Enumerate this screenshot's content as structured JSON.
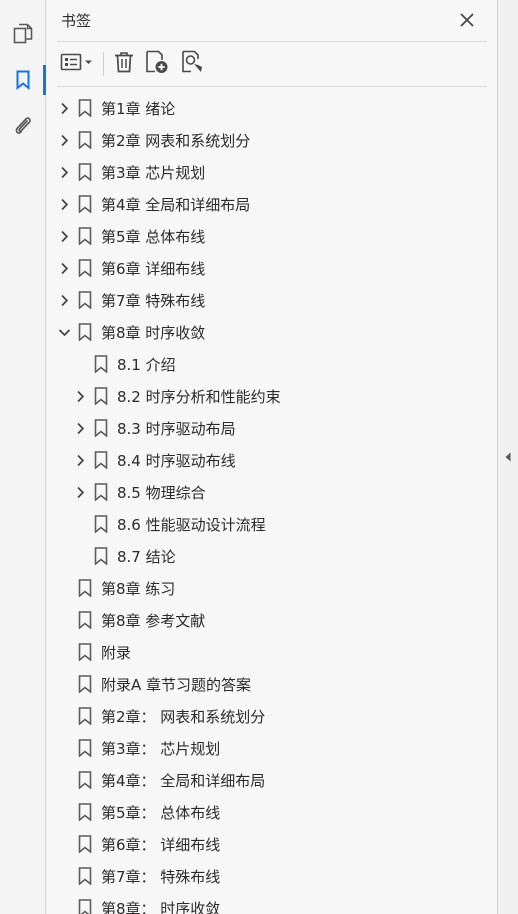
{
  "left_rail": {
    "items": [
      {
        "icon": "pages-icon",
        "active": false
      },
      {
        "icon": "bookmark-icon",
        "active": true
      },
      {
        "icon": "paperclip-icon",
        "active": false
      }
    ],
    "accent": "#1473e6"
  },
  "panel": {
    "title": "书签",
    "toolbar": [
      {
        "icon": "options-menu-icon"
      },
      {
        "icon": "delete-icon"
      },
      {
        "icon": "new-bookmark-icon"
      },
      {
        "icon": "find-bookmark-icon"
      }
    ]
  },
  "bookmarks": [
    {
      "label": "第1章 绪论",
      "level": 0,
      "expandable": true,
      "expanded": false
    },
    {
      "label": "第2章 网表和系统划分",
      "level": 0,
      "expandable": true,
      "expanded": false
    },
    {
      "label": "第3章 芯片规划",
      "level": 0,
      "expandable": true,
      "expanded": false
    },
    {
      "label": "第4章 全局和详细布局",
      "level": 0,
      "expandable": true,
      "expanded": false
    },
    {
      "label": "第5章 总体布线",
      "level": 0,
      "expandable": true,
      "expanded": false
    },
    {
      "label": "第6章 详细布线",
      "level": 0,
      "expandable": true,
      "expanded": false
    },
    {
      "label": "第7章 特殊布线",
      "level": 0,
      "expandable": true,
      "expanded": false
    },
    {
      "label": "第8章 时序收敛",
      "level": 0,
      "expandable": true,
      "expanded": true
    },
    {
      "label": "8.1 介绍",
      "level": 1,
      "expandable": false,
      "expanded": false
    },
    {
      "label": "8.2 时序分析和性能约束",
      "level": 1,
      "expandable": true,
      "expanded": false
    },
    {
      "label": "8.3 时序驱动布局",
      "level": 1,
      "expandable": true,
      "expanded": false
    },
    {
      "label": "8.4 时序驱动布线",
      "level": 1,
      "expandable": true,
      "expanded": false
    },
    {
      "label": "8.5 物理综合",
      "level": 1,
      "expandable": true,
      "expanded": false
    },
    {
      "label": "8.6 性能驱动设计流程",
      "level": 1,
      "expandable": false,
      "expanded": false
    },
    {
      "label": "8.7 结论",
      "level": 1,
      "expandable": false,
      "expanded": false
    },
    {
      "label": "第8章 练习",
      "level": 0,
      "expandable": false,
      "expanded": false
    },
    {
      "label": "第8章 参考文献",
      "level": 0,
      "expandable": false,
      "expanded": false
    },
    {
      "label": "附录",
      "level": 0,
      "expandable": false,
      "expanded": false
    },
    {
      "label": "附录A 章节习题的答案",
      "level": 0,
      "expandable": false,
      "expanded": false
    },
    {
      "label": "第2章： 网表和系统划分",
      "level": 0,
      "expandable": false,
      "expanded": false
    },
    {
      "label": "第3章： 芯片规划",
      "level": 0,
      "expandable": false,
      "expanded": false
    },
    {
      "label": "第4章： 全局和详细布局",
      "level": 0,
      "expandable": false,
      "expanded": false
    },
    {
      "label": "第5章： 总体布线",
      "level": 0,
      "expandable": false,
      "expanded": false
    },
    {
      "label": "第6章： 详细布线",
      "level": 0,
      "expandable": false,
      "expanded": false
    },
    {
      "label": "第7章： 特殊布线",
      "level": 0,
      "expandable": false,
      "expanded": false
    },
    {
      "label": "第8章： 时序收敛",
      "level": 0,
      "expandable": false,
      "expanded": false
    }
  ]
}
